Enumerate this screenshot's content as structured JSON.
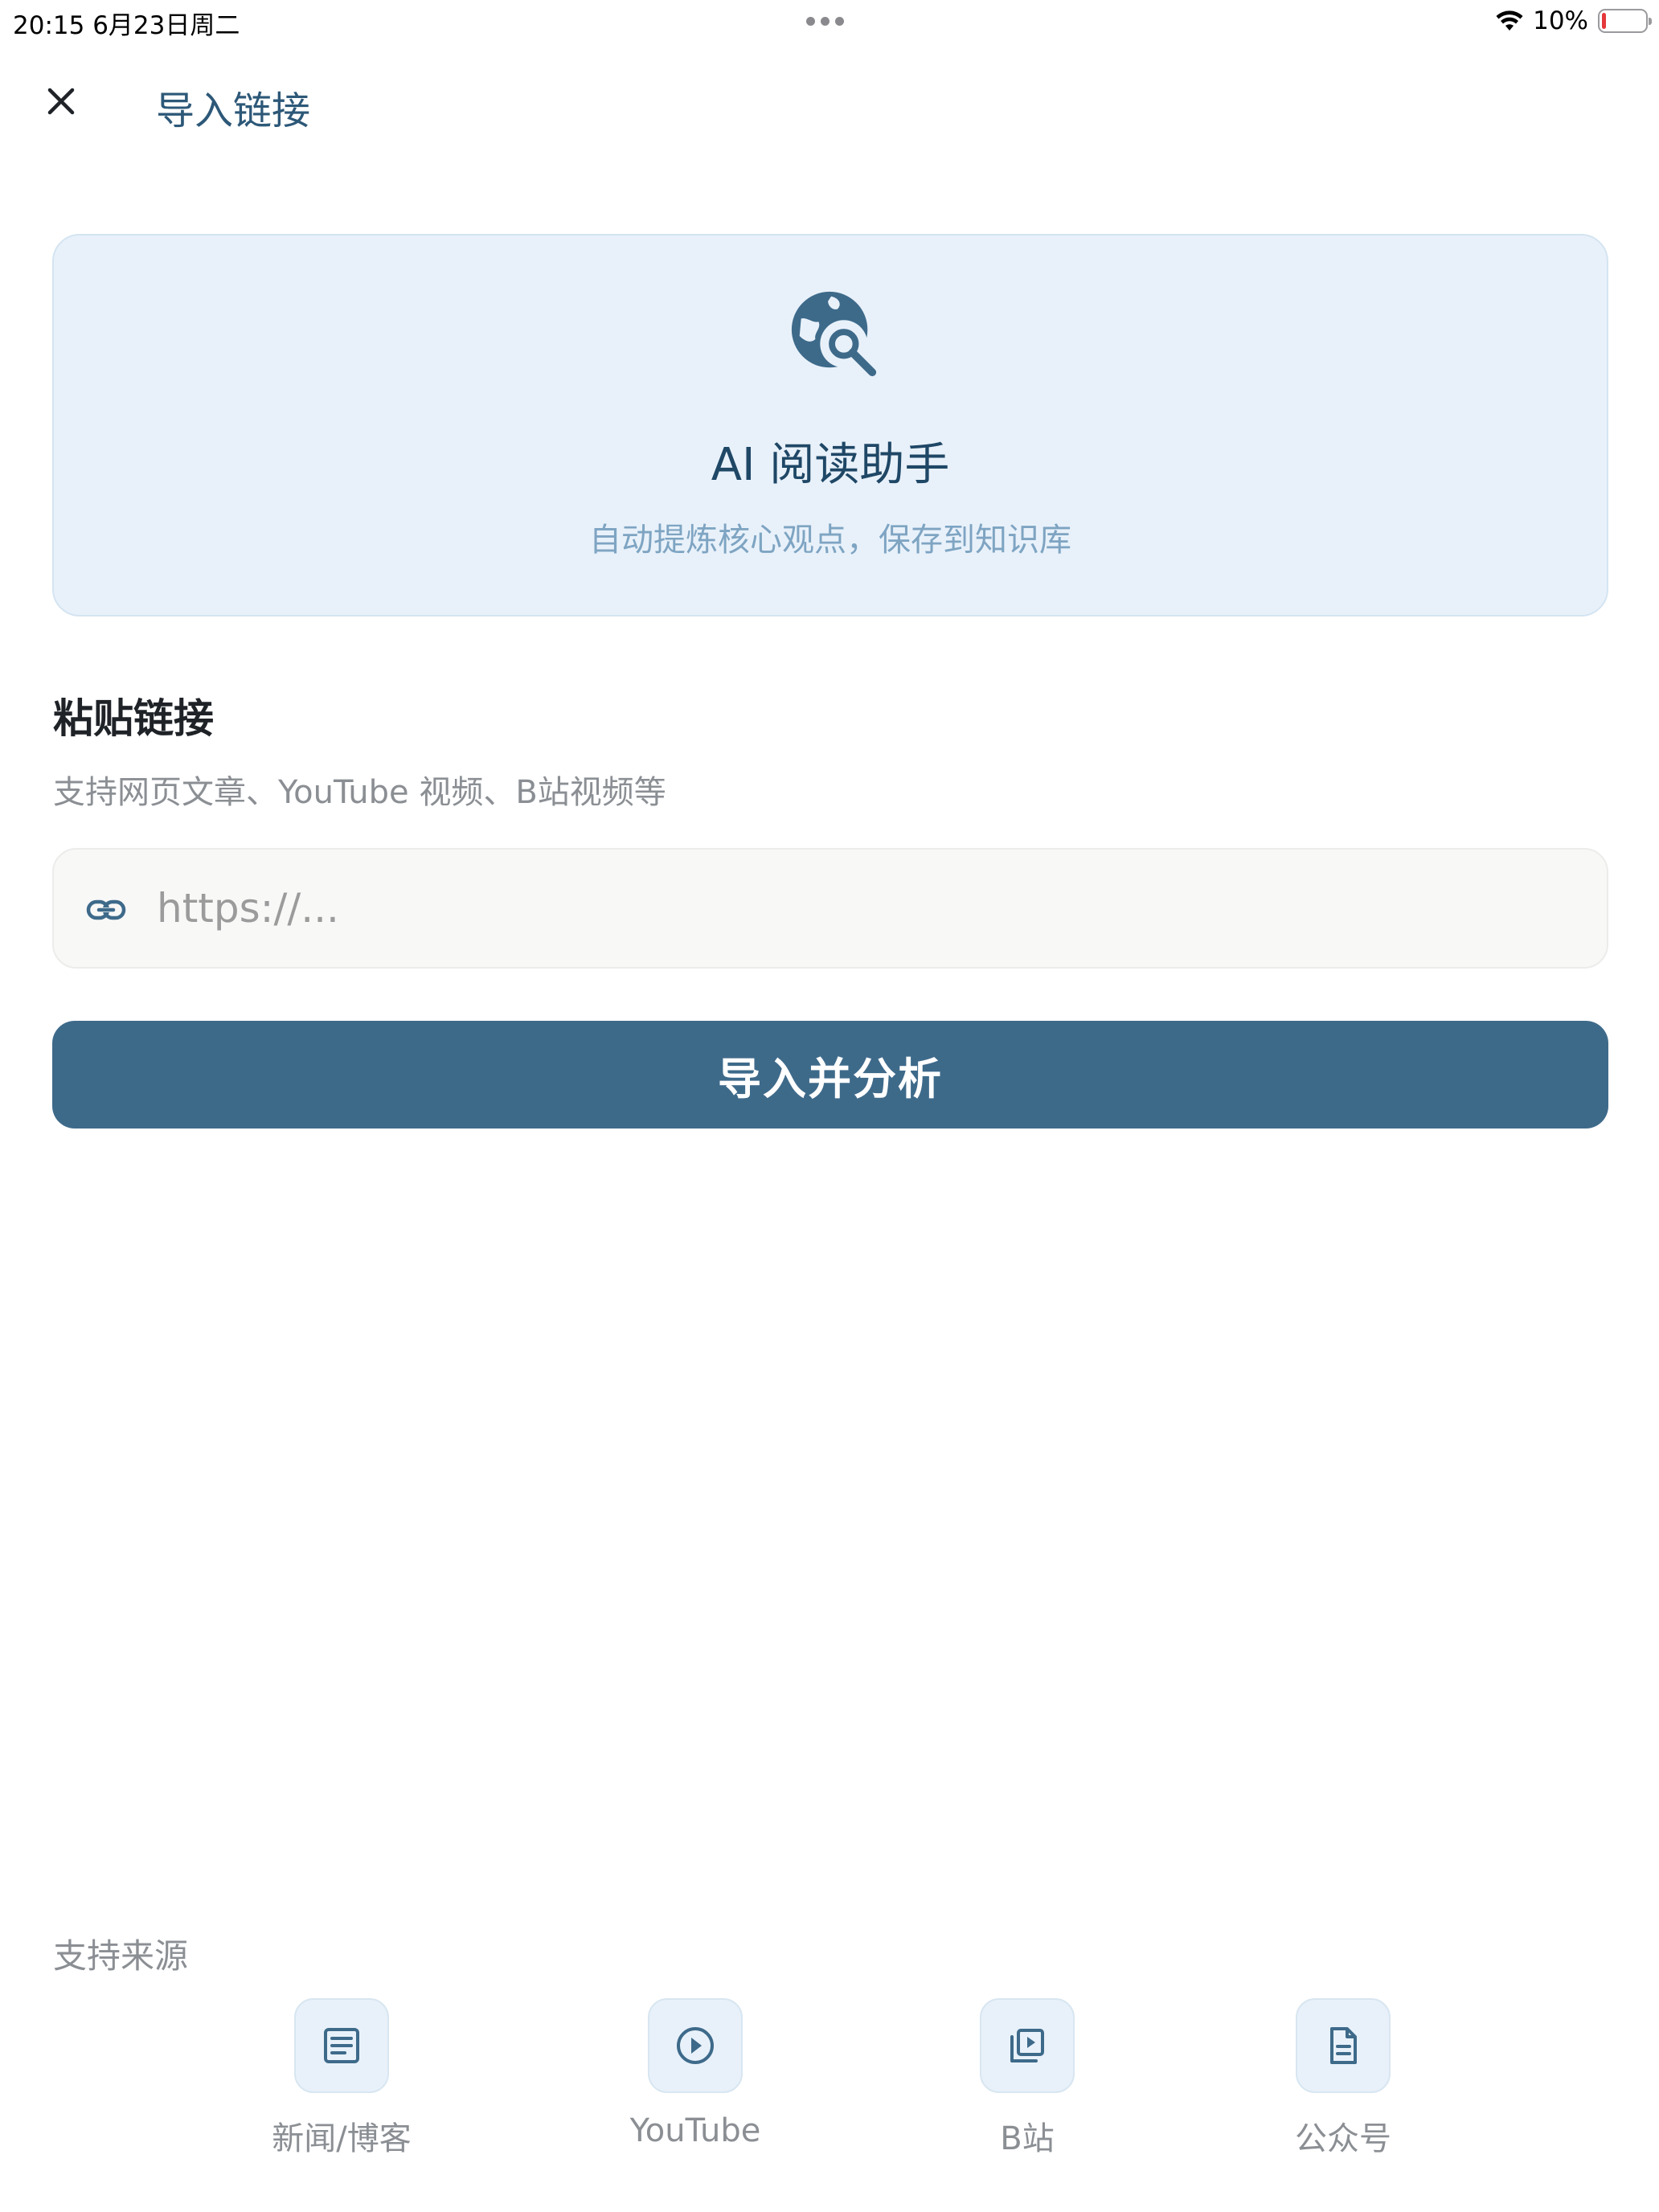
{
  "status_bar": {
    "time_date": "20:15   6月23日周二",
    "battery": "10%",
    "battery_level": 0.1
  },
  "header": {
    "close_icon": "close-icon",
    "title": "导入链接"
  },
  "hero": {
    "icon": "globe-search-icon",
    "title": "AI 阅读助手",
    "subtitle": "自动提炼核心观点，保存到知识库"
  },
  "paste_section": {
    "title": "粘贴链接",
    "hint": "支持网页文章、YouTube 视频、B站视频等",
    "input_icon": "link-icon",
    "input_value": "",
    "input_placeholder": "https://..."
  },
  "primary_button": {
    "label": "导入并分析"
  },
  "sources": {
    "title": "支持来源",
    "items": [
      {
        "label": "新闻/博客",
        "icon": "article-icon"
      },
      {
        "label": "YouTube",
        "icon": "play-circle-icon"
      },
      {
        "label": "B站",
        "icon": "video-library-icon"
      },
      {
        "label": "公众号",
        "icon": "document-icon"
      }
    ]
  },
  "colors": {
    "accent": "#3e6a8a",
    "card_background": "#e8f1fa",
    "title_text": "#2d5878",
    "muted_text": "#8b8f94"
  }
}
